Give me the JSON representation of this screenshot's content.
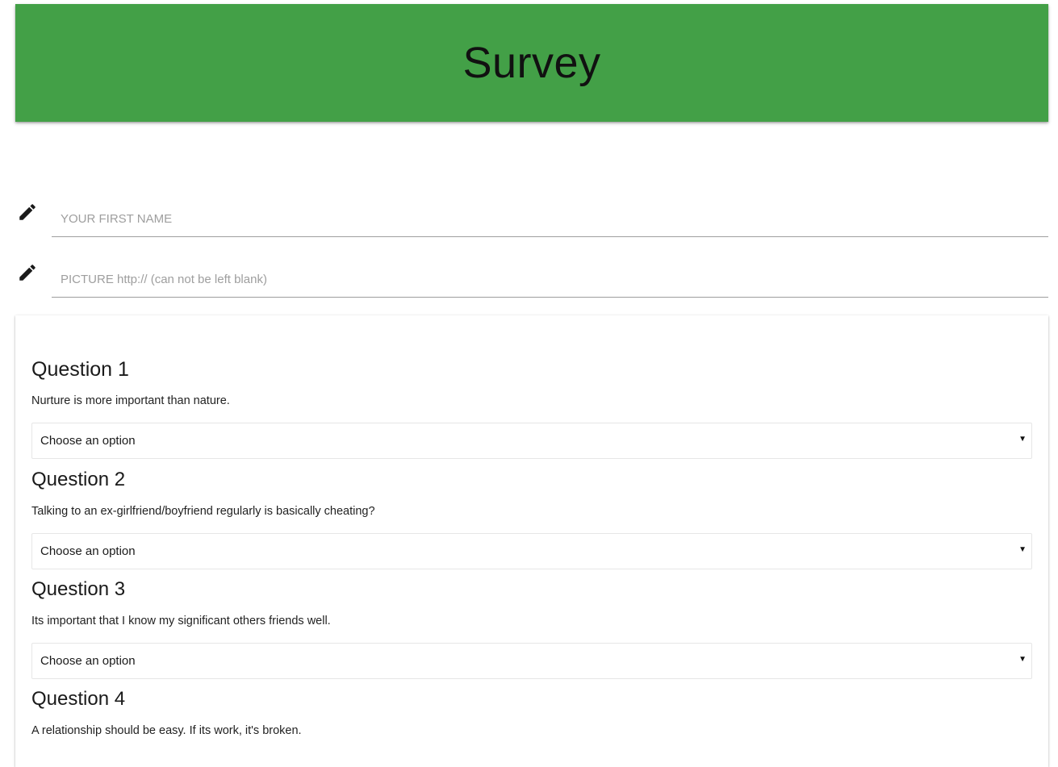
{
  "header": {
    "title": "Survey",
    "bg_color": "#43a047"
  },
  "fields": [
    {
      "placeholder": "YOUR FIRST NAME",
      "value": "",
      "icon": "pencil-icon"
    },
    {
      "placeholder": "PICTURE http:// (can not be left blank)",
      "value": "",
      "icon": "pencil-icon"
    }
  ],
  "questions": [
    {
      "title": "Question 1",
      "text": "Nurture is more important than nature.",
      "select": "Choose an option"
    },
    {
      "title": "Question 2",
      "text": "Talking to an ex-girlfriend/boyfriend regularly is basically cheating?",
      "select": "Choose an option"
    },
    {
      "title": "Question 3",
      "text": "Its important that I know my significant others friends well.",
      "select": "Choose an option"
    },
    {
      "title": "Question 4",
      "text": "A relationship should be easy. If its work, it's broken.",
      "select": ""
    }
  ],
  "caret_glyph": "▼"
}
